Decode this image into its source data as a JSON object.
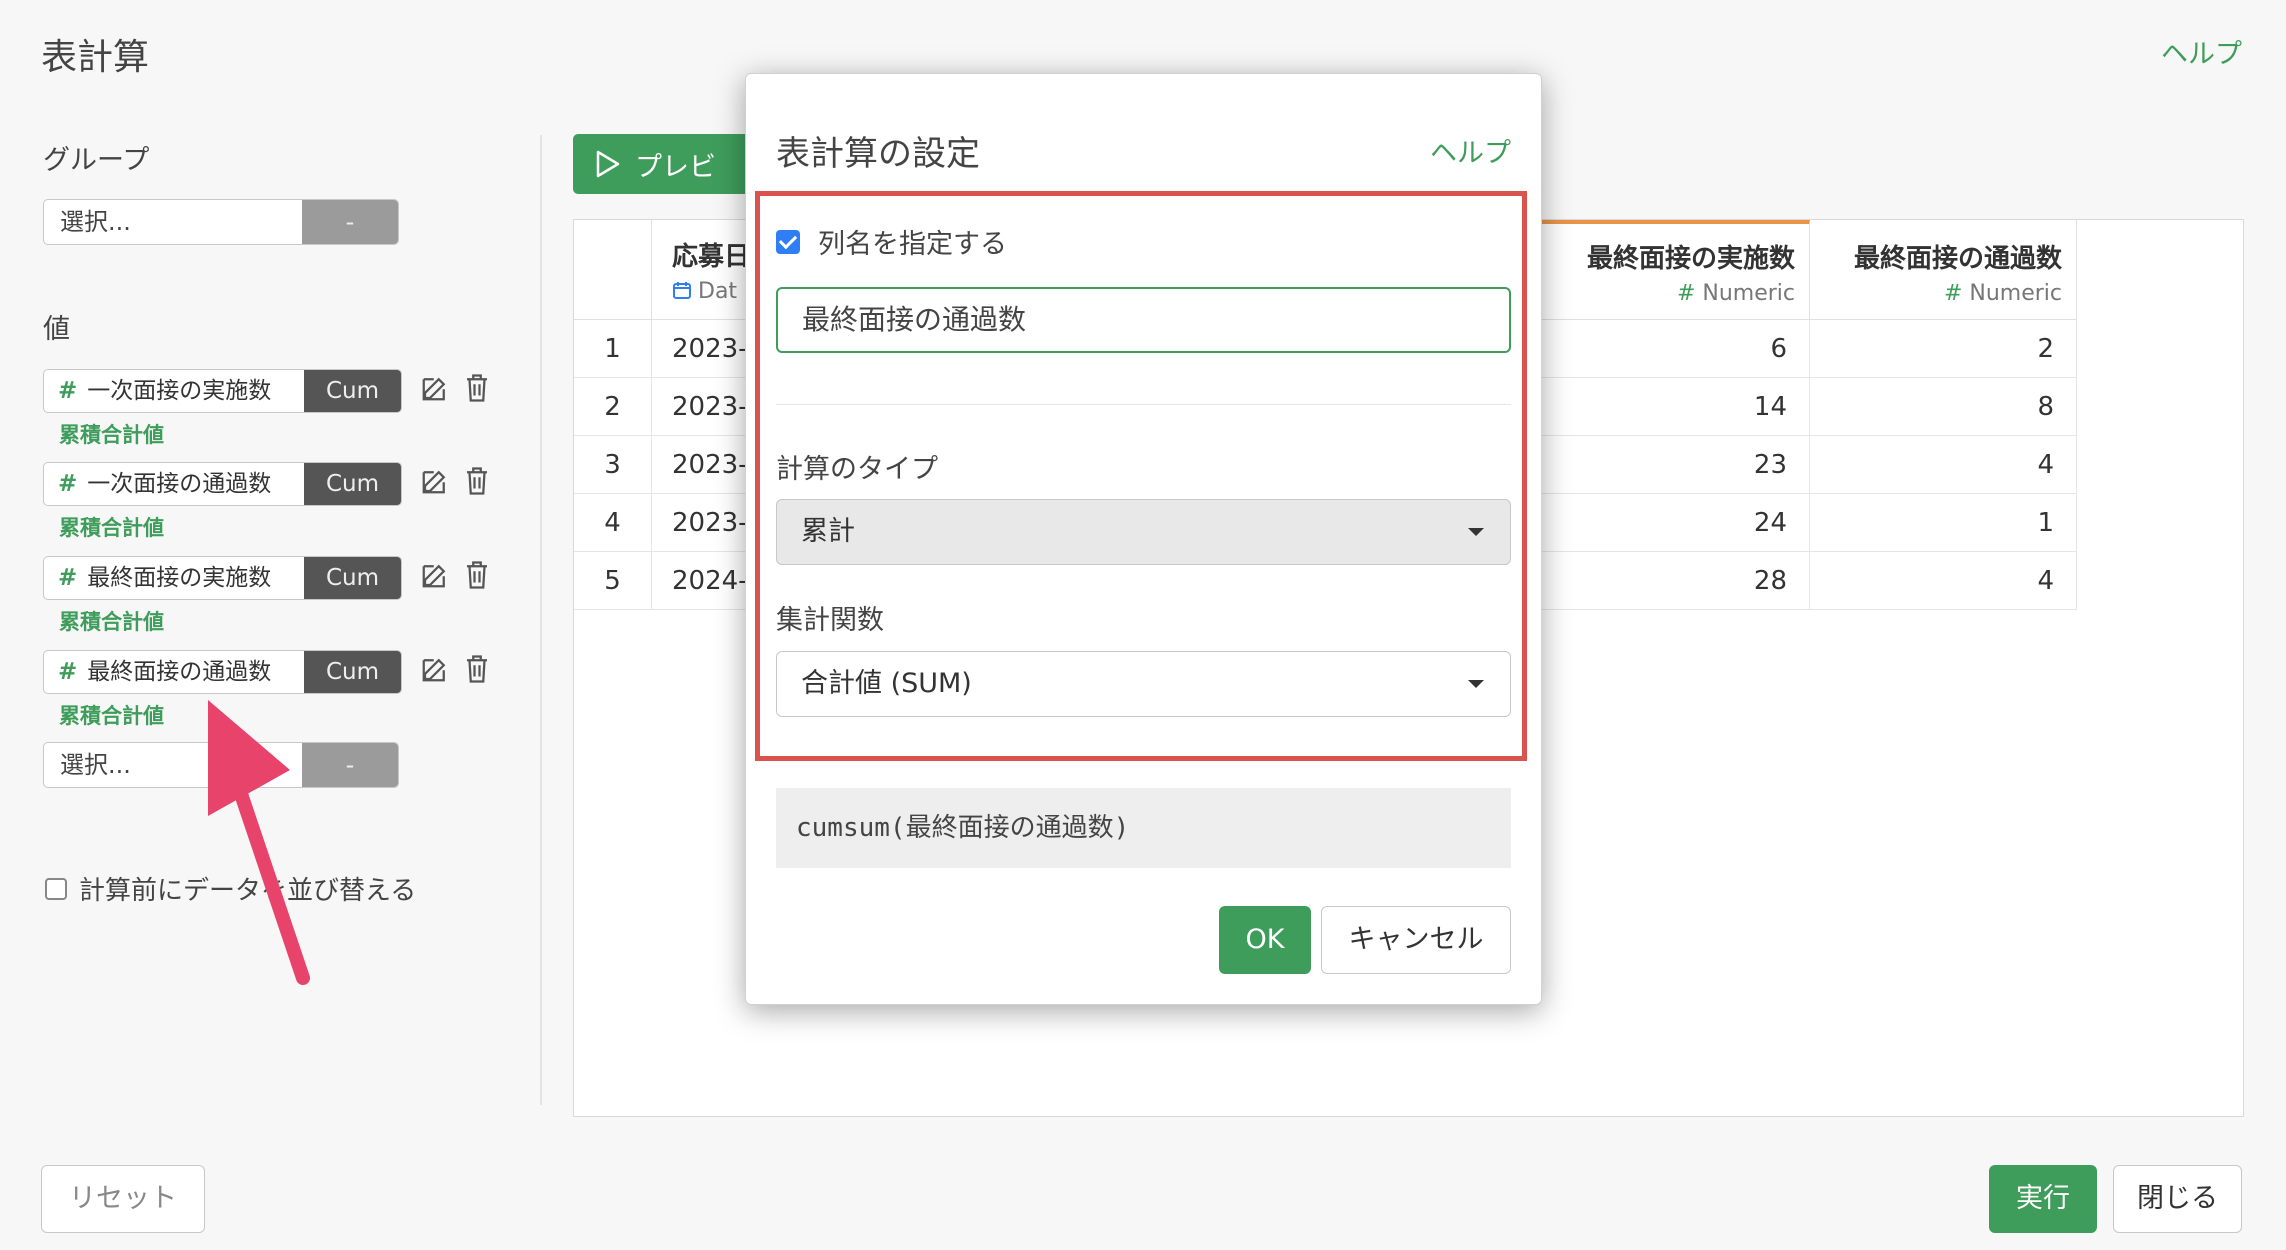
{
  "header": {
    "title": "表計算",
    "help": "ヘルプ"
  },
  "left": {
    "group_label": "グループ",
    "group_select": {
      "placeholder": "選択...",
      "dash": "-"
    },
    "values_label": "値",
    "values": [
      {
        "hash": "#",
        "name": "一次面接の実施数",
        "tag": "Cum",
        "sub": "累積合計値"
      },
      {
        "hash": "#",
        "name": "一次面接の通過数",
        "tag": "Cum",
        "sub": "累積合計値"
      },
      {
        "hash": "#",
        "name": "最終面接の実施数",
        "tag": "Cum",
        "sub": "累積合計値"
      },
      {
        "hash": "#",
        "name": "最終面接の通過数",
        "tag": "Cum",
        "sub": "累積合計値"
      }
    ],
    "value_select": {
      "placeholder": "選択...",
      "dash": "-"
    },
    "sort_checkbox_label": "計算前にデータを並び替える"
  },
  "preview": {
    "label": "プレビ"
  },
  "table": {
    "columns": [
      {
        "name": "応募日",
        "type": "Dat"
      },
      {
        "name": "最終面接の実施数",
        "type": "Numeric"
      },
      {
        "name": "最終面接の通過数",
        "type": "Numeric"
      }
    ],
    "type_hash": "#",
    "rows": [
      {
        "index": "1",
        "date": "2023-",
        "final_done": "6",
        "final_pass": "2"
      },
      {
        "index": "2",
        "date": "2023-",
        "final_done": "14",
        "final_pass": "8"
      },
      {
        "index": "3",
        "date": "2023-",
        "final_done": "23",
        "final_pass": "4"
      },
      {
        "index": "4",
        "date": "2023-",
        "final_done": "24",
        "final_pass": "1"
      },
      {
        "index": "5",
        "date": "2024-",
        "final_done": "28",
        "final_pass": "4"
      }
    ]
  },
  "modal": {
    "title": "表計算の設定",
    "help": "ヘルプ",
    "specify_name_label": "列名を指定する",
    "specify_name_checked": true,
    "column_name_value": "最終面接の通過数",
    "calc_type_label": "計算のタイプ",
    "calc_type_value": "累計",
    "agg_label": "集計関数",
    "agg_value": "合計値 (SUM)",
    "formula": "cumsum(最終面接の通過数)",
    "ok": "OK",
    "cancel": "キャンセル"
  },
  "footer": {
    "reset": "リセット",
    "run": "実行",
    "close": "閉じる"
  },
  "colors": {
    "accent": "#3f9d5b",
    "highlight": "#d9534f",
    "arrow": "#e8436b"
  }
}
